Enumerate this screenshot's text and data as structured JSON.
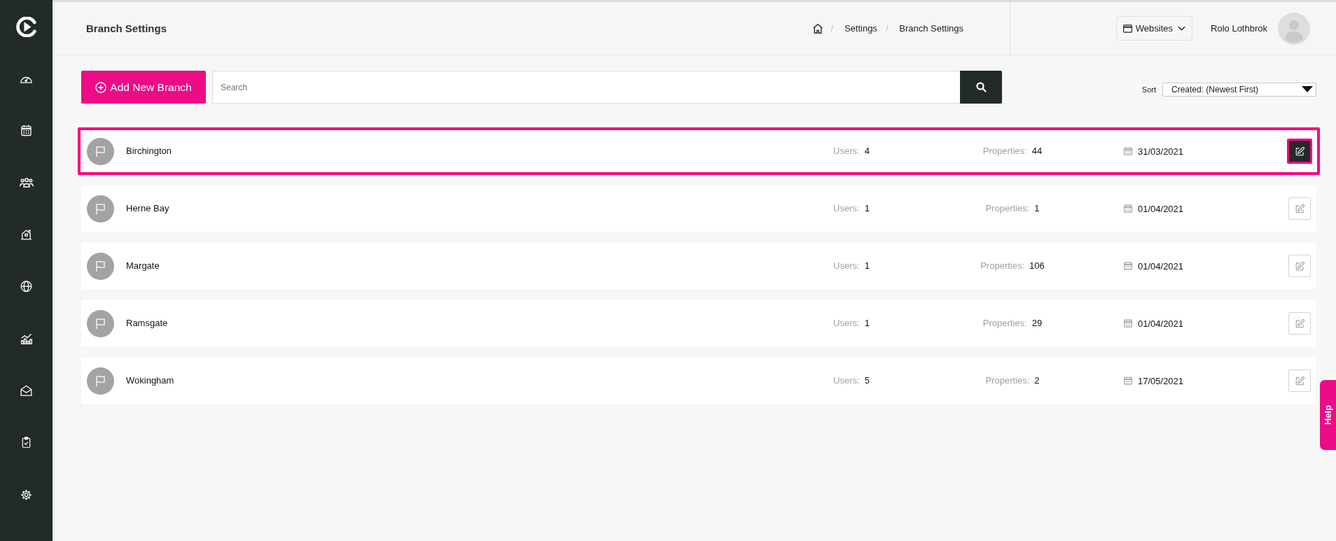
{
  "header": {
    "title": "Branch Settings",
    "breadcrumb": [
      {
        "separator": "/",
        "label": "Settings"
      },
      {
        "separator": "/",
        "label": "Branch Settings"
      }
    ],
    "websites_button": "Websites",
    "user_name": "Rolo Lothbrok"
  },
  "toolbar": {
    "add_button": "Add New Branch",
    "search": {
      "placeholder": "Search"
    },
    "sort": {
      "label": "Sort",
      "value": "Created: (Newest First)"
    }
  },
  "branches": [
    {
      "name": "Birchington",
      "users_label": "Users:",
      "users": "4",
      "properties_label": "Properties:",
      "properties": "44",
      "created": "31/03/2021",
      "selected": true
    },
    {
      "name": "Herne Bay",
      "users_label": "Users:",
      "users": "1",
      "properties_label": "Properties:",
      "properties": "1",
      "created": "01/04/2021",
      "selected": false
    },
    {
      "name": "Margate",
      "users_label": "Users:",
      "users": "1",
      "properties_label": "Properties:",
      "properties": "106",
      "created": "01/04/2021",
      "selected": false
    },
    {
      "name": "Ramsgate",
      "users_label": "Users:",
      "users": "1",
      "properties_label": "Properties:",
      "properties": "29",
      "created": "01/04/2021",
      "selected": false
    },
    {
      "name": "Wokingham",
      "users_label": "Users:",
      "users": "5",
      "properties_label": "Properties:",
      "properties": "2",
      "created": "17/05/2021",
      "selected": false
    }
  ],
  "help_tab": "Help"
}
